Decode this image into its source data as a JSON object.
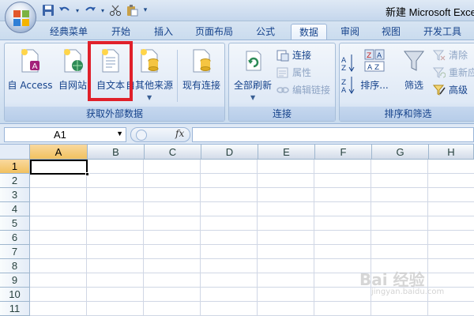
{
  "window": {
    "title": "新建 Microsoft Excel"
  },
  "quick_access": [
    "save-icon",
    "undo-icon",
    "redo-icon",
    "cut-icon",
    "paste-icon",
    "customize-icon"
  ],
  "tabs": [
    {
      "label": "经典菜单"
    },
    {
      "label": "开始"
    },
    {
      "label": "插入"
    },
    {
      "label": "页面布局"
    },
    {
      "label": "公式"
    },
    {
      "label": "数据",
      "active": true
    },
    {
      "label": "审阅"
    },
    {
      "label": "视图"
    },
    {
      "label": "开发工具"
    }
  ],
  "ribbon": {
    "get_external": {
      "label": "获取外部数据",
      "buttons": [
        "自 Access",
        "自网站",
        "自文本",
        "自其他来源",
        "现有连接"
      ]
    },
    "connections": {
      "label": "连接",
      "refresh_all": "全部刷新",
      "items": [
        "连接",
        "属性",
        "编辑链接"
      ]
    },
    "sort_filter": {
      "label": "排序和筛选",
      "sort": "排序...",
      "filter": "筛选",
      "items": [
        "清除",
        "重新应",
        "高级"
      ]
    }
  },
  "formula_bar": {
    "name_box": "A1",
    "fx": "fx",
    "value": ""
  },
  "grid": {
    "columns": [
      "A",
      "B",
      "C",
      "D",
      "E",
      "F",
      "G",
      "H"
    ],
    "rows": [
      "1",
      "2",
      "3",
      "4",
      "5",
      "6",
      "7",
      "8",
      "9",
      "10",
      "11"
    ],
    "active_cell": "A1"
  },
  "watermark": {
    "text": "Bai 经验",
    "sub": "jingyan.baidu.com"
  },
  "colors": {
    "highlight": "#e0202a",
    "selected_header": "#f1c15f"
  }
}
